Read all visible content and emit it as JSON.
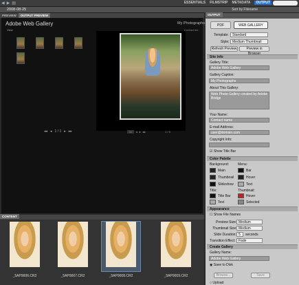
{
  "topbar": {
    "workspaces": [
      "ESSENTIALS",
      "FILMSTRIP",
      "METADATA",
      "OUTPUT"
    ],
    "active_workspace": "OUTPUT"
  },
  "pathbar": {
    "folder": "2008-08-25",
    "sort_label": "Sort by Filename"
  },
  "preview": {
    "tab_preview": "PREVIEW",
    "tab_output": "OUTPUT PREVIEW",
    "gallery_title": "Adobe Web Gallery",
    "gallery_caption": "My Photographs",
    "view_label": "View",
    "contact_label": "Contact me",
    "page_indicator": "1 / 1",
    "image_counter": "1 / 5"
  },
  "content": {
    "tab": "CONTENT",
    "files": [
      "_5AP9006.CR2",
      "_5AP9007.CR2",
      "_5AP9008.CR2",
      "_5AP9009.CR2"
    ]
  },
  "output": {
    "panel_title": "OUTPUT",
    "pdf_label": "PDF",
    "web_gallery_label": "WEB GALLERY",
    "template_label": "Template:",
    "template_value": "Standard",
    "style_label": "Style:",
    "style_value": "Medium Thumbnail",
    "refresh_label": "Refresh Preview",
    "preview_browser_label": "Preview in Browser",
    "site_info": "Site Info",
    "gallery_title_label": "Gallery Title:",
    "gallery_title_value": "Adobe Web Gallery",
    "gallery_caption_label": "Gallery Caption:",
    "gallery_caption_value": "My Photographs",
    "about_label": "About This Gallery:",
    "about_value": "Web Photo Gallery created by Adobe Bridge",
    "your_name_label": "Your Name:",
    "your_name_value": "Contact name",
    "email_label": "E-mail Address:",
    "email_value": "user@domain.com",
    "copyright_label": "Copyright Info:",
    "show_title_bar": "Show Title Bar",
    "color_palette": "Color Palette",
    "background_label": "Background:",
    "menu_label": "Menu:",
    "main": "Main",
    "thumbnail": "Thumbnail",
    "slideshow": "Slideshow",
    "bar": "Bar",
    "hover": "Hover",
    "text": "Text",
    "title_label": "Title:",
    "thumbnail_label": "Thumbnail:",
    "title_bar": "Title Bar",
    "selected": "Selected",
    "appearance": "Appearance",
    "show_file_names": "Show File Names",
    "preview_size_label": "Preview Size:",
    "preview_size_value": "Medium",
    "thumb_size_label": "Thumbnail Size:",
    "thumb_size_value": "Medium",
    "slide_duration_label": "Slide Duration:",
    "slide_duration_value": "5",
    "slide_duration_unit": "seconds",
    "transition_label": "Transition Effect:",
    "transition_value": "Fade",
    "create_gallery": "Create Gallery",
    "gallery_name_label": "Gallery Name:",
    "gallery_name_value": "Adobe Web Gallery",
    "save_to_disk": "Save to Disk",
    "browse_label": "Browse...",
    "save_label": "Save",
    "upload_label": "Upload"
  },
  "colors": {
    "accent": "#2f6fd0",
    "title_bar_red": "#c82020",
    "hover_dark": "#222222"
  }
}
